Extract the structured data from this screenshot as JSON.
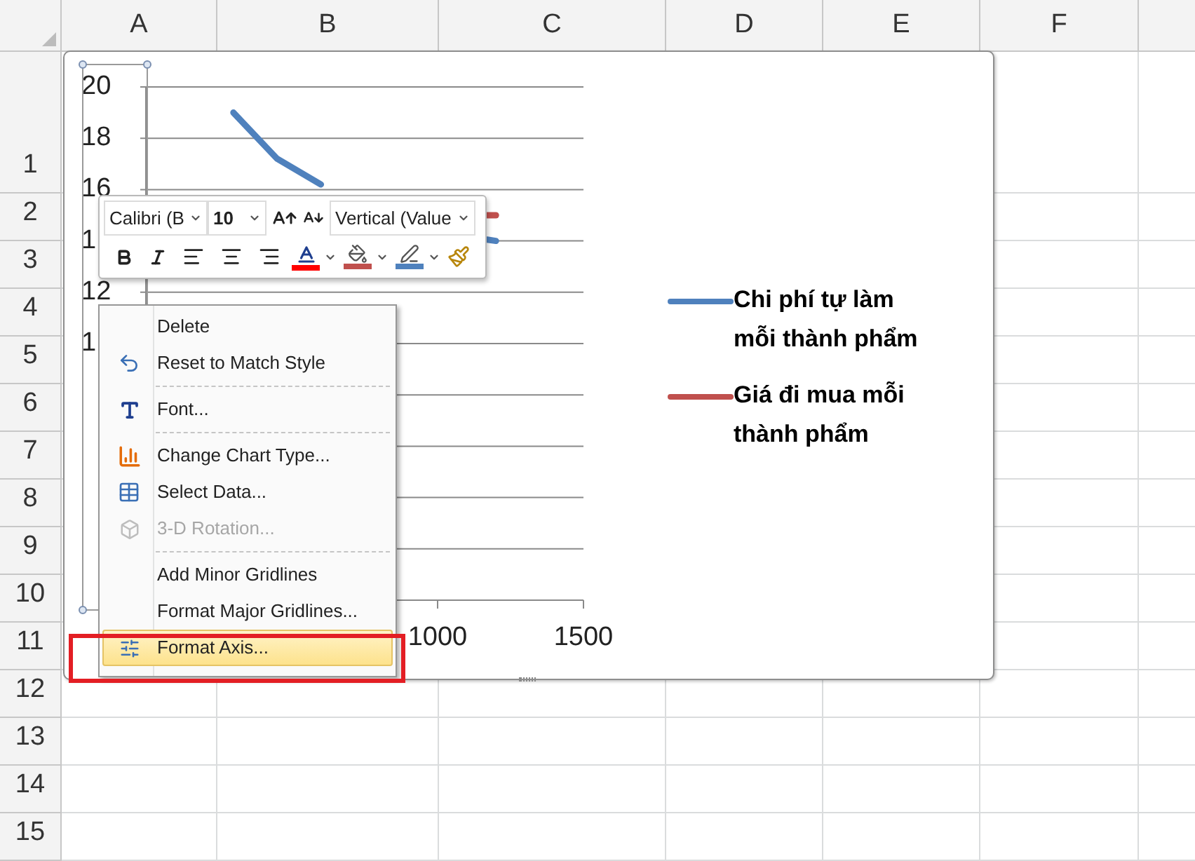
{
  "sheet": {
    "columns": [
      "A",
      "B",
      "C",
      "D",
      "E",
      "F"
    ],
    "rows": [
      "1",
      "2",
      "3",
      "4",
      "5",
      "6",
      "7",
      "8",
      "9",
      "10",
      "11",
      "12",
      "13",
      "14",
      "15"
    ]
  },
  "chart": {
    "chart_data": {
      "type": "line",
      "x": [
        300,
        450,
        600,
        800,
        1000,
        1170,
        1200
      ],
      "series": [
        {
          "name": "Chi phí tự làm mỗi thành phẩm",
          "color": "#4f81bd",
          "values": [
            19,
            17.2,
            16.2,
            null,
            null,
            14.05,
            14
          ]
        },
        {
          "name": "Giá đi mua mỗi thành phẩm",
          "color": "#c0504d",
          "values": [
            null,
            null,
            null,
            null,
            null,
            15,
            15
          ]
        }
      ],
      "xlim": [
        0,
        1500
      ],
      "ylim": [
        0,
        20
      ],
      "xticks": [
        1000,
        1500
      ],
      "yticks": [
        12,
        16,
        18,
        20
      ],
      "grid": true,
      "legend": true
    },
    "partial_tick_labels": [
      "1",
      "1"
    ]
  },
  "mini_toolbar": {
    "font_name": "Calibri (B",
    "font_size": "10",
    "chart_element": "Vertical (Value"
  },
  "context_menu": [
    {
      "label": "Delete",
      "separator_before": false,
      "disabled": false,
      "selected": false
    },
    {
      "label": "Reset to Match Style",
      "separator_before": false,
      "disabled": false,
      "selected": false
    },
    {
      "label": "Font...",
      "separator_before": true,
      "disabled": false,
      "selected": false
    },
    {
      "label": "Change Chart Type...",
      "separator_before": true,
      "disabled": false,
      "selected": false
    },
    {
      "label": "Select Data...",
      "separator_before": false,
      "disabled": false,
      "selected": false
    },
    {
      "label": "3-D Rotation...",
      "separator_before": false,
      "disabled": true,
      "selected": false
    },
    {
      "label": "Add Minor Gridlines",
      "separator_before": true,
      "disabled": false,
      "selected": false
    },
    {
      "label": "Format Major Gridlines...",
      "separator_before": false,
      "disabled": false,
      "selected": false
    },
    {
      "label": "Format Axis...",
      "separator_before": false,
      "disabled": false,
      "selected": true
    }
  ]
}
